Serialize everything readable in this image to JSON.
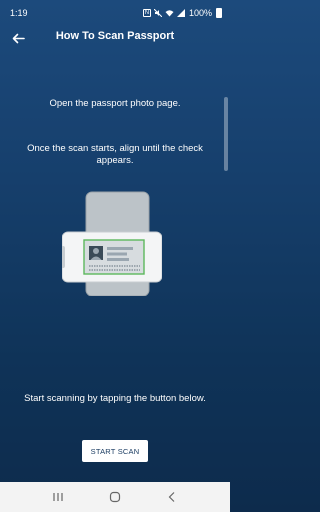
{
  "status": {
    "time": "1:19",
    "battery": "100%"
  },
  "header": {
    "title": "How To Scan Passport",
    "back_icon": "arrow-left-icon"
  },
  "instructions": {
    "step1": "Open the passport photo page.",
    "step2": "Once the scan starts, align until the check appears.",
    "step3": "Start scanning by tapping the button below."
  },
  "actions": {
    "start_scan_label": "START SCAN"
  },
  "navigation": {
    "items": [
      "recent-apps-icon",
      "home-icon",
      "back-icon"
    ]
  },
  "colors": {
    "background_top": "#1c4a7c",
    "background_bottom": "#0d2b4c",
    "accent_green": "#5cb85c",
    "button_text": "#1c3d62"
  }
}
